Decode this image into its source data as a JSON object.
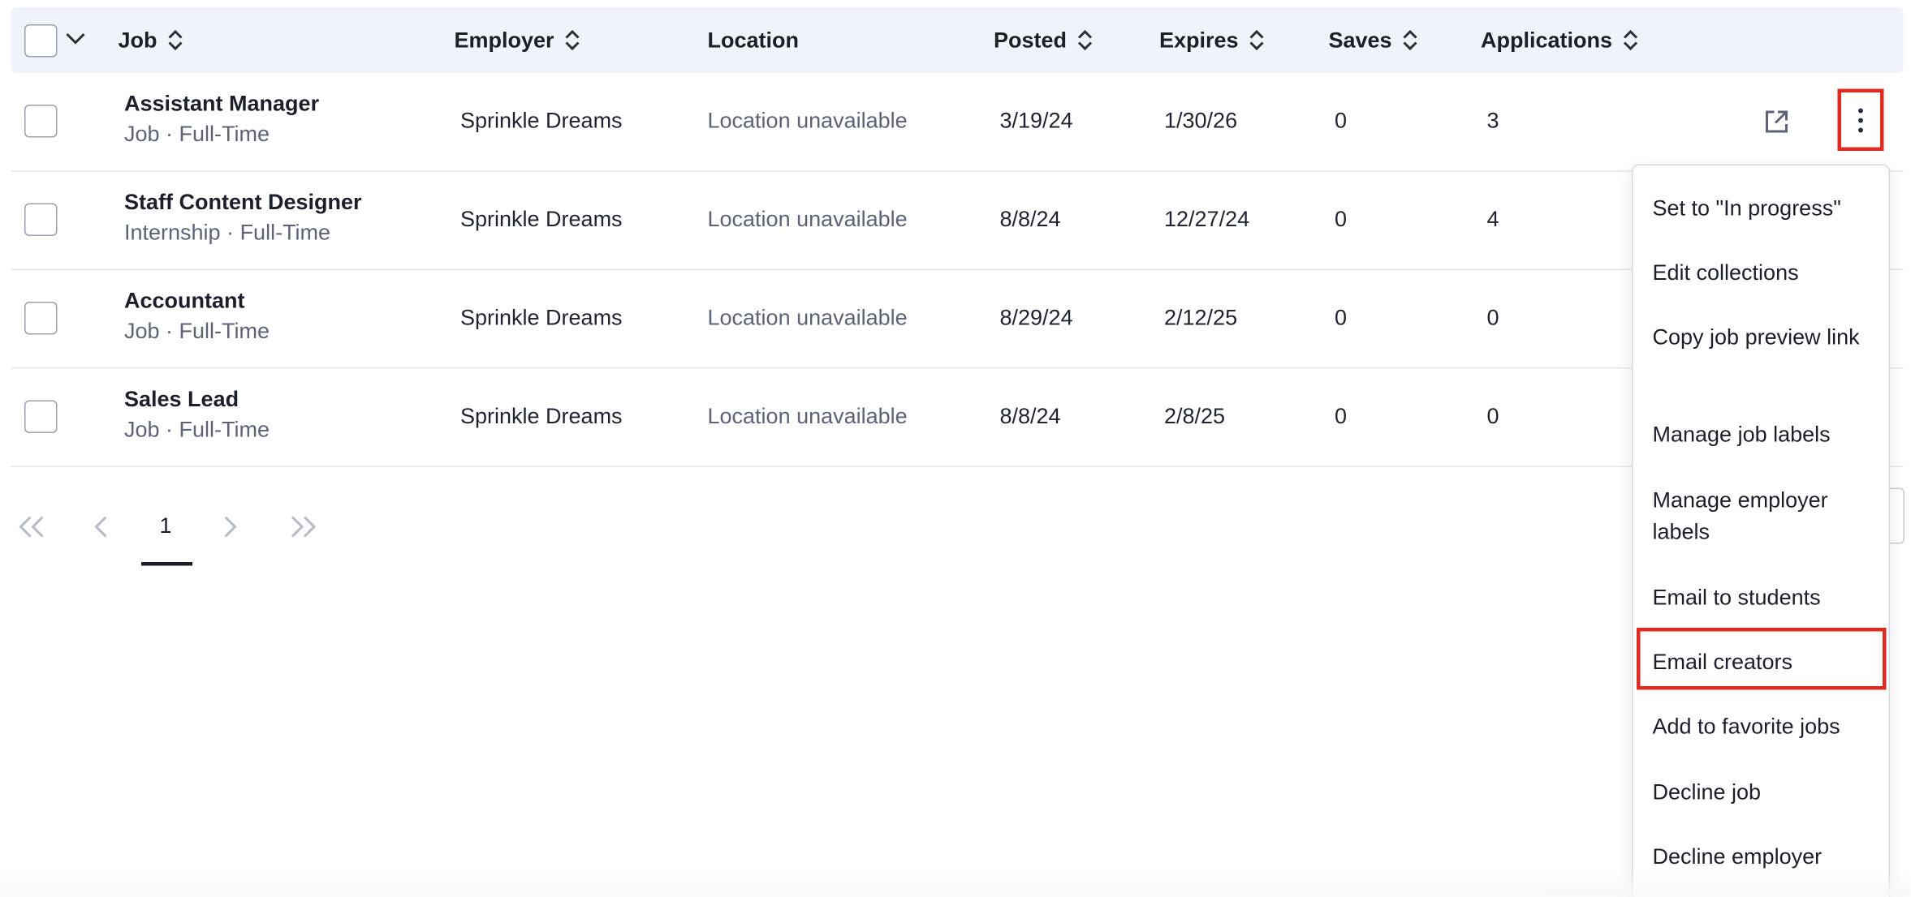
{
  "table": {
    "columns": [
      {
        "label": "Job",
        "sortable": true
      },
      {
        "label": "Employer",
        "sortable": true
      },
      {
        "label": "Location",
        "sortable": false
      },
      {
        "label": "Posted",
        "sortable": true
      },
      {
        "label": "Expires",
        "sortable": true
      },
      {
        "label": "Saves",
        "sortable": true
      },
      {
        "label": "Applications",
        "sortable": true
      }
    ],
    "rows": [
      {
        "title": "Assistant Manager",
        "subtitle": "Job · Full-Time",
        "employer": "Sprinkle Dreams",
        "location": "Location unavailable",
        "posted": "3/19/24",
        "expires": "1/30/26",
        "saves": "0",
        "applications": "3"
      },
      {
        "title": "Staff Content Designer",
        "subtitle": "Internship · Full-Time",
        "employer": "Sprinkle Dreams",
        "location": "Location unavailable",
        "posted": "8/8/24",
        "expires": "12/27/24",
        "saves": "0",
        "applications": "4"
      },
      {
        "title": "Accountant",
        "subtitle": "Job · Full-Time",
        "employer": "Sprinkle Dreams",
        "location": "Location unavailable",
        "posted": "8/29/24",
        "expires": "2/12/25",
        "saves": "0",
        "applications": "0"
      },
      {
        "title": "Sales Lead",
        "subtitle": "Job · Full-Time",
        "employer": "Sprinkle Dreams",
        "location": "Location unavailable",
        "posted": "8/8/24",
        "expires": "2/8/25",
        "saves": "0",
        "applications": "0"
      }
    ]
  },
  "pagination": {
    "current_page": "1"
  },
  "menu": {
    "items": [
      "Set to \"In progress\"",
      "Edit collections",
      "Copy job preview link",
      "Manage job labels",
      "Manage employer labels",
      "Email to students",
      "Email creators",
      "Add to favorite jobs",
      "Decline job",
      "Decline employer"
    ],
    "highlighted": "Email creators"
  },
  "colors": {
    "header_bg": "#f0f3fa",
    "highlight": "#e0291f",
    "muted_text": "#5d6277"
  },
  "icons": {
    "sort": "sort-updown-icon",
    "external": "external-link-icon",
    "more": "kebab-menu-icon"
  }
}
